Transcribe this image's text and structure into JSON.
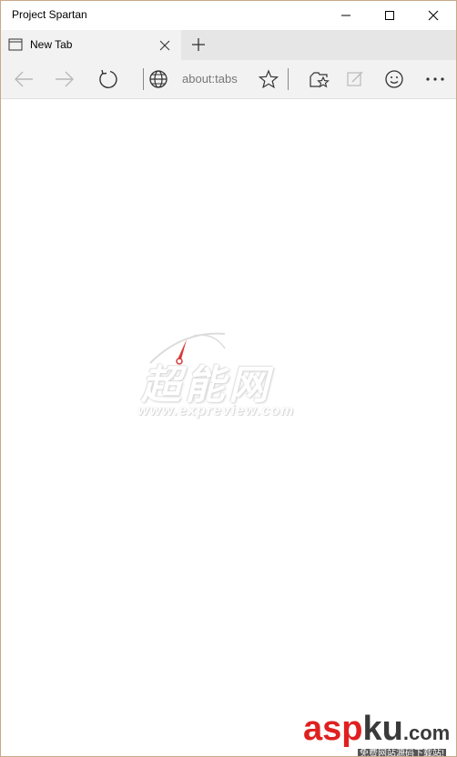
{
  "window": {
    "title": "Project Spartan"
  },
  "tabs": [
    {
      "label": "New Tab"
    }
  ],
  "toolbar": {
    "address": "about:tabs"
  },
  "watermark": {
    "brand": "超能网",
    "url": "www.expreview.com"
  },
  "corner_logo": {
    "brand_red": "asp",
    "brand_dark": "ku",
    "suffix": ".com",
    "tagline": "免费网站源码下载站!"
  },
  "colors": {
    "titlebar": "#ffffff",
    "tabstrip": "#e6e6e6",
    "active_tab": "#f2f2f2",
    "toolbar": "#f2f2f2",
    "content": "#ffffff",
    "accent_red": "#e02020"
  },
  "icons": {
    "minimize": "minimize-icon",
    "maximize": "maximize-icon",
    "close": "close-icon",
    "tab": "tab-page-icon",
    "tab_close": "tab-close-icon",
    "new_tab": "plus-icon",
    "back": "back-arrow-icon",
    "forward": "forward-arrow-icon",
    "refresh": "refresh-icon",
    "globe": "globe-icon",
    "favorite": "star-icon",
    "hub": "hub-star-icon",
    "note": "web-note-icon",
    "feedback": "smiley-icon",
    "more": "more-icon"
  }
}
